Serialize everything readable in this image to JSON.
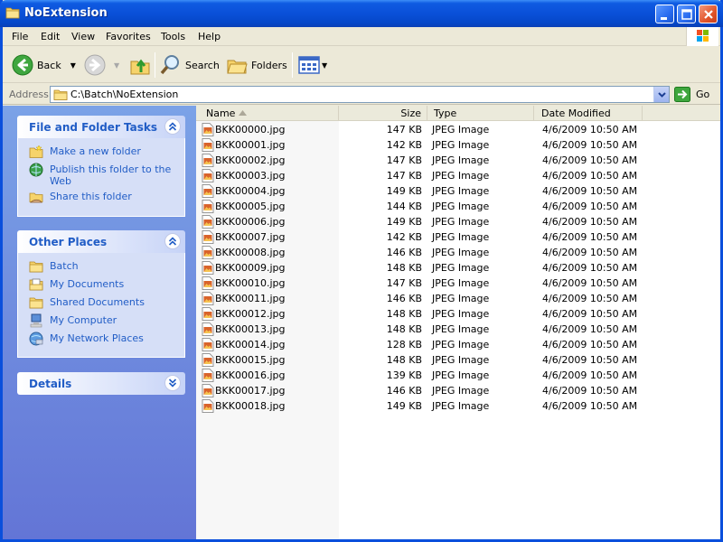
{
  "window": {
    "title": "NoExtension"
  },
  "menu": [
    "File",
    "Edit",
    "View",
    "Favorites",
    "Tools",
    "Help"
  ],
  "toolbar": {
    "back": "Back",
    "search": "Search",
    "folders": "Folders"
  },
  "address": {
    "label": "Address",
    "value": "C:\\Batch\\NoExtension",
    "go": "Go"
  },
  "sidebar": {
    "tasks": {
      "title": "File and Folder Tasks",
      "items": [
        "Make a new folder",
        "Publish this folder to the Web",
        "Share this folder"
      ]
    },
    "places": {
      "title": "Other Places",
      "items": [
        "Batch",
        "My Documents",
        "Shared Documents",
        "My Computer",
        "My Network Places"
      ]
    },
    "details": {
      "title": "Details"
    }
  },
  "columns": {
    "name": "Name",
    "size": "Size",
    "type": "Type",
    "date": "Date Modified"
  },
  "files": [
    {
      "name": "BKK00000.jpg",
      "size": "147 KB",
      "type": "JPEG Image",
      "date": "4/6/2009 10:50 AM"
    },
    {
      "name": "BKK00001.jpg",
      "size": "142 KB",
      "type": "JPEG Image",
      "date": "4/6/2009 10:50 AM"
    },
    {
      "name": "BKK00002.jpg",
      "size": "147 KB",
      "type": "JPEG Image",
      "date": "4/6/2009 10:50 AM"
    },
    {
      "name": "BKK00003.jpg",
      "size": "147 KB",
      "type": "JPEG Image",
      "date": "4/6/2009 10:50 AM"
    },
    {
      "name": "BKK00004.jpg",
      "size": "149 KB",
      "type": "JPEG Image",
      "date": "4/6/2009 10:50 AM"
    },
    {
      "name": "BKK00005.jpg",
      "size": "144 KB",
      "type": "JPEG Image",
      "date": "4/6/2009 10:50 AM"
    },
    {
      "name": "BKK00006.jpg",
      "size": "149 KB",
      "type": "JPEG Image",
      "date": "4/6/2009 10:50 AM"
    },
    {
      "name": "BKK00007.jpg",
      "size": "142 KB",
      "type": "JPEG Image",
      "date": "4/6/2009 10:50 AM"
    },
    {
      "name": "BKK00008.jpg",
      "size": "146 KB",
      "type": "JPEG Image",
      "date": "4/6/2009 10:50 AM"
    },
    {
      "name": "BKK00009.jpg",
      "size": "148 KB",
      "type": "JPEG Image",
      "date": "4/6/2009 10:50 AM"
    },
    {
      "name": "BKK00010.jpg",
      "size": "147 KB",
      "type": "JPEG Image",
      "date": "4/6/2009 10:50 AM"
    },
    {
      "name": "BKK00011.jpg",
      "size": "146 KB",
      "type": "JPEG Image",
      "date": "4/6/2009 10:50 AM"
    },
    {
      "name": "BKK00012.jpg",
      "size": "148 KB",
      "type": "JPEG Image",
      "date": "4/6/2009 10:50 AM"
    },
    {
      "name": "BKK00013.jpg",
      "size": "148 KB",
      "type": "JPEG Image",
      "date": "4/6/2009 10:50 AM"
    },
    {
      "name": "BKK00014.jpg",
      "size": "128 KB",
      "type": "JPEG Image",
      "date": "4/6/2009 10:50 AM"
    },
    {
      "name": "BKK00015.jpg",
      "size": "148 KB",
      "type": "JPEG Image",
      "date": "4/6/2009 10:50 AM"
    },
    {
      "name": "BKK00016.jpg",
      "size": "139 KB",
      "type": "JPEG Image",
      "date": "4/6/2009 10:50 AM"
    },
    {
      "name": "BKK00017.jpg",
      "size": "146 KB",
      "type": "JPEG Image",
      "date": "4/6/2009 10:50 AM"
    },
    {
      "name": "BKK00018.jpg",
      "size": "149 KB",
      "type": "JPEG Image",
      "date": "4/6/2009 10:50 AM"
    }
  ],
  "colors": {
    "titlebar": "#0a50d8",
    "sidebar_link": "#215dc6",
    "sidebar_bg": "#6f8fe0"
  }
}
